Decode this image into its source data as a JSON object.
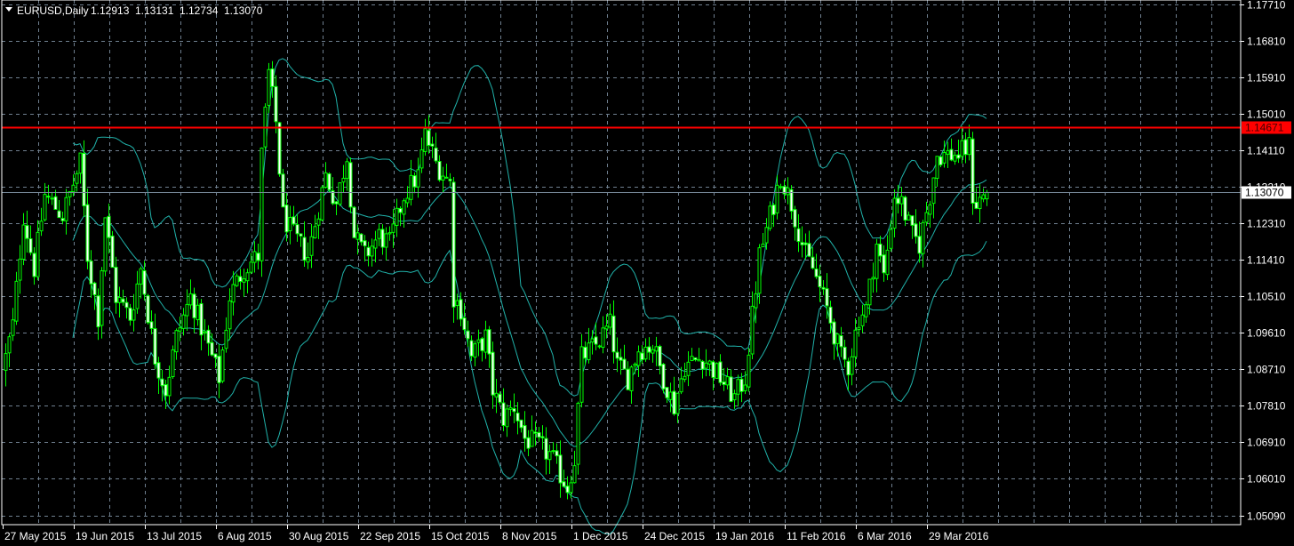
{
  "header": {
    "symbol_period": "EURUSD,Daily",
    "ohlc": [
      "1.12913",
      "1.13131",
      "1.12734",
      "1.13070"
    ],
    "menu_icon": "triangle-down-icon"
  },
  "colors": {
    "background": "#000000",
    "candle": "#00ff00",
    "bands": "#20b2aa",
    "hline": "#ff0000",
    "bid_line": "#778899",
    "axis": "#ffffff"
  },
  "chart_data": {
    "type": "candlestick",
    "title": "EURUSD,Daily",
    "indicator": "Bollinger Bands (20, 2)",
    "ylim": [
      1.0487,
      1.1782
    ],
    "price_ticks": [
      "1.17710",
      "1.16810",
      "1.15910",
      "1.15010",
      "1.14110",
      "1.13210",
      "1.12310",
      "1.11410",
      "1.10510",
      "1.09610",
      "1.08710",
      "1.07810",
      "1.06910",
      "1.06010",
      "1.05090"
    ],
    "date_ticks": [
      "27 May 2015",
      "19 Jun 2015",
      "13 Jul 2015",
      "6 Aug 2015",
      "30 Aug 2015",
      "22 Sep 2015",
      "15 Oct 2015",
      "8 Nov 2015",
      "1 Dec 2015",
      "24 Dec 2015",
      "19 Jan 2016",
      "11 Feb 2016",
      "6 Mar 2016",
      "29 Mar 2016"
    ],
    "bars_per_date_tick": 20,
    "bar_count": 277,
    "close_anchors": [
      [
        0,
        1.09
      ],
      [
        2,
        1.098
      ],
      [
        5,
        1.125
      ],
      [
        8,
        1.112
      ],
      [
        11,
        1.13
      ],
      [
        16,
        1.125
      ],
      [
        21,
        1.138
      ],
      [
        23,
        1.115
      ],
      [
        26,
        1.1
      ],
      [
        28,
        1.125
      ],
      [
        31,
        1.105
      ],
      [
        35,
        1.1
      ],
      [
        38,
        1.112
      ],
      [
        42,
        1.09
      ],
      [
        45,
        1.082
      ],
      [
        48,
        1.095
      ],
      [
        52,
        1.105
      ],
      [
        56,
        1.095
      ],
      [
        60,
        1.085
      ],
      [
        63,
        1.105
      ],
      [
        67,
        1.112
      ],
      [
        71,
        1.115
      ],
      [
        72,
        1.14
      ],
      [
        74,
        1.16
      ],
      [
        76,
        1.148
      ],
      [
        78,
        1.125
      ],
      [
        81,
        1.12
      ],
      [
        85,
        1.115
      ],
      [
        90,
        1.135
      ],
      [
        93,
        1.128
      ],
      [
        96,
        1.14
      ],
      [
        98,
        1.12
      ],
      [
        101,
        1.115
      ],
      [
        105,
        1.12
      ],
      [
        108,
        1.118
      ],
      [
        112,
        1.13
      ],
      [
        116,
        1.135
      ],
      [
        118,
        1.145
      ],
      [
        121,
        1.138
      ],
      [
        125,
        1.133
      ],
      [
        126,
        1.105
      ],
      [
        128,
        1.102
      ],
      [
        131,
        1.09
      ],
      [
        135,
        1.095
      ],
      [
        137,
        1.082
      ],
      [
        140,
        1.075
      ],
      [
        143,
        1.078
      ],
      [
        146,
        1.07
      ],
      [
        150,
        1.068
      ],
      [
        153,
        1.066
      ],
      [
        158,
        1.058
      ],
      [
        160,
        1.065
      ],
      [
        162,
        1.09
      ],
      [
        166,
        1.093
      ],
      [
        170,
        1.098
      ],
      [
        172,
        1.088
      ],
      [
        175,
        1.085
      ],
      [
        178,
        1.092
      ],
      [
        182,
        1.093
      ],
      [
        185,
        1.085
      ],
      [
        188,
        1.078
      ],
      [
        191,
        1.088
      ],
      [
        196,
        1.09
      ],
      [
        201,
        1.085
      ],
      [
        205,
        1.08
      ],
      [
        208,
        1.085
      ],
      [
        212,
        1.115
      ],
      [
        216,
        1.128
      ],
      [
        218,
        1.135
      ],
      [
        221,
        1.128
      ],
      [
        225,
        1.115
      ],
      [
        227,
        1.112
      ],
      [
        231,
        1.102
      ],
      [
        235,
        1.09
      ],
      [
        237,
        1.088
      ],
      [
        240,
        1.1
      ],
      [
        242,
        1.102
      ],
      [
        245,
        1.118
      ],
      [
        247,
        1.11
      ],
      [
        250,
        1.13
      ],
      [
        252,
        1.128
      ],
      [
        255,
        1.12
      ],
      [
        257,
        1.118
      ],
      [
        260,
        1.13
      ],
      [
        262,
        1.14
      ],
      [
        265,
        1.14
      ],
      [
        268,
        1.14
      ],
      [
        271,
        1.142
      ],
      [
        272,
        1.13
      ],
      [
        273,
        1.128
      ],
      [
        276,
        1.1307
      ]
    ],
    "last_bar": {
      "open": 1.12913,
      "high": 1.13131,
      "low": 1.12734,
      "close": 1.1307
    },
    "horizontal_line": {
      "price": 1.14671,
      "label": "1.14671"
    },
    "bid_line": {
      "price": 1.1307,
      "label": "1.13070"
    }
  }
}
